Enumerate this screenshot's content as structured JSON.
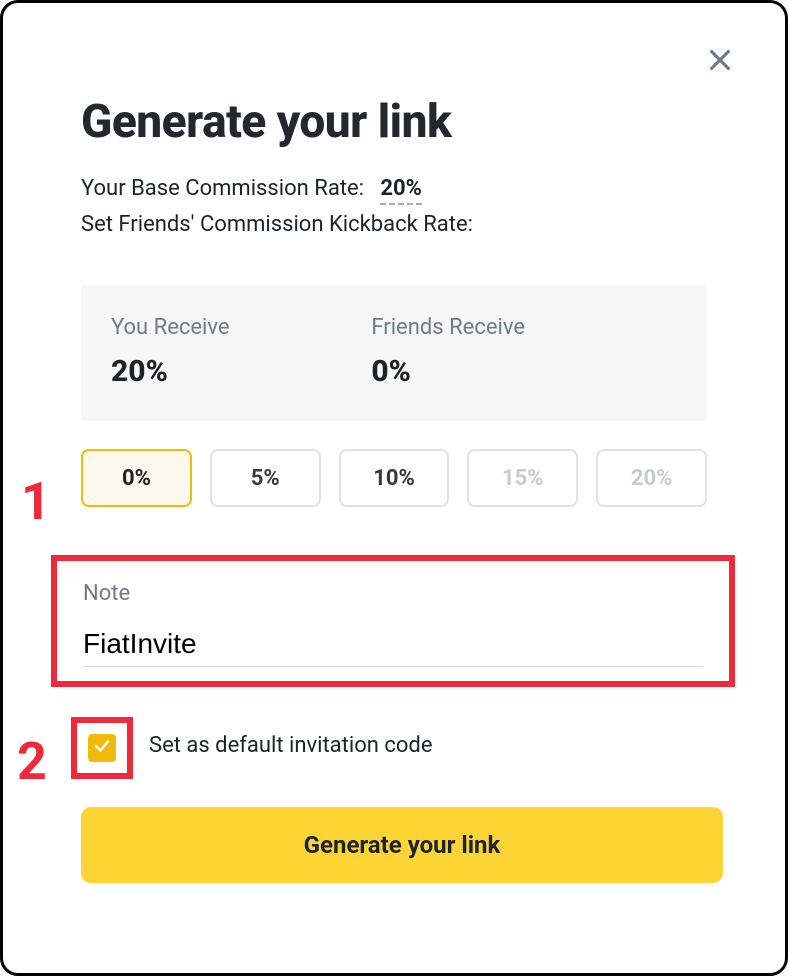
{
  "title": "Generate your link",
  "base_rate_label": "Your Base Commission Rate:",
  "base_rate_value": "20%",
  "kickback_label": "Set Friends' Commission Kickback Rate:",
  "panel": {
    "you_label": "You Receive",
    "you_value": "20%",
    "friends_label": "Friends Receive",
    "friends_value": "0%"
  },
  "options": {
    "opt0": "0%",
    "opt1": "5%",
    "opt2": "10%",
    "opt3": "15%",
    "opt4": "20%"
  },
  "note_label": "Note",
  "note_value": "FiatInvite",
  "default_label": "Set as default invitation code",
  "generate_label": "Generate your link",
  "annotations": {
    "a1": "1",
    "a2": "2"
  },
  "colors": {
    "accent": "#F0B90B",
    "button": "#FCD535",
    "callout": "#EC2A3B"
  }
}
